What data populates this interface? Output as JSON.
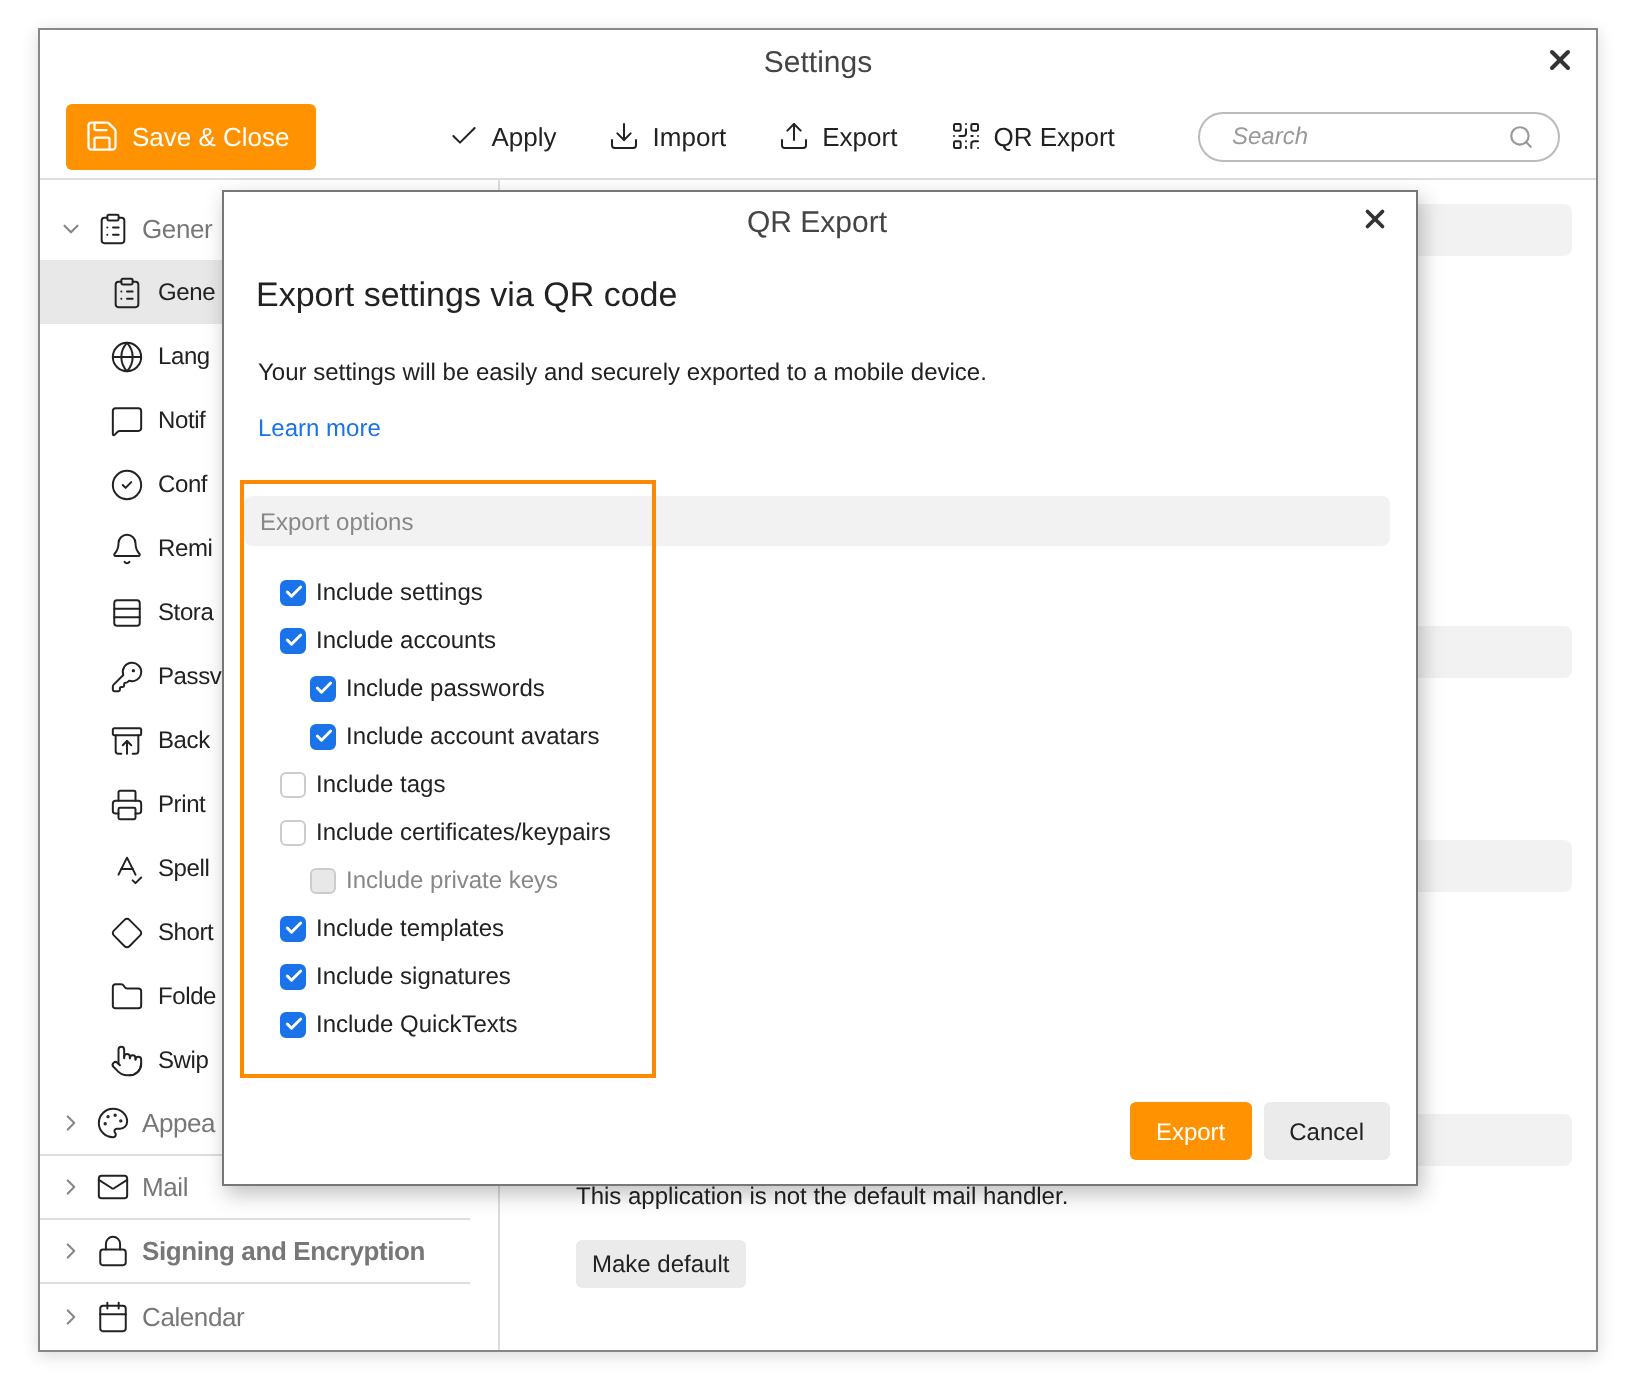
{
  "window": {
    "title": "Settings"
  },
  "toolbar": {
    "primary": "Save & Close",
    "actions": [
      "Apply",
      "Import",
      "Export",
      "QR Export"
    ],
    "search": {
      "placeholder": "Search"
    }
  },
  "sidebar": {
    "groups": [
      {
        "label": "Gener",
        "expanded": true,
        "children": [
          {
            "label": "Gene",
            "selected": true
          },
          {
            "label": "Lang",
            "selected": false
          },
          {
            "label": "Notif",
            "selected": false
          },
          {
            "label": "Conf",
            "selected": false
          },
          {
            "label": "Remi",
            "selected": false
          },
          {
            "label": "Stora",
            "selected": false
          },
          {
            "label": "Passv",
            "selected": false
          },
          {
            "label": "Back",
            "selected": false
          },
          {
            "label": "Print",
            "selected": false
          },
          {
            "label": "Spell",
            "selected": false
          },
          {
            "label": "Short",
            "selected": false
          },
          {
            "label": "Folde",
            "selected": false
          },
          {
            "label": "Swip",
            "selected": false
          }
        ]
      },
      {
        "label": "Appea",
        "expanded": false
      },
      {
        "label": "Mail",
        "expanded": false
      },
      {
        "label": "Signing and Encryption",
        "expanded": false
      },
      {
        "label": "Calendar",
        "expanded": false
      }
    ]
  },
  "content": {
    "notice": "This application is not the default mail handler.",
    "button": "Make default"
  },
  "dialog": {
    "title": "QR Export",
    "heading": "Export settings via QR code",
    "description": "Your settings will be easily and securely exported to a mobile device.",
    "link": "Learn more",
    "options": {
      "title": "Export options",
      "highlighted": true,
      "items": [
        {
          "label": "Include settings",
          "checked": true,
          "disabled": false
        },
        {
          "label": "Include accounts",
          "checked": true,
          "disabled": false,
          "children": [
            {
              "label": "Include passwords",
              "checked": true,
              "disabled": false
            },
            {
              "label": "Include account avatars",
              "checked": true,
              "disabled": false
            }
          ]
        },
        {
          "label": "Include tags",
          "checked": false,
          "disabled": false
        },
        {
          "label": "Include certificates/keypairs",
          "checked": false,
          "disabled": false,
          "children": [
            {
              "label": "Include private keys",
              "checked": false,
              "disabled": true
            }
          ]
        },
        {
          "label": "Include templates",
          "checked": true,
          "disabled": false
        },
        {
          "label": "Include signatures",
          "checked": true,
          "disabled": false
        },
        {
          "label": "Include QuickTexts",
          "checked": true,
          "disabled": false
        }
      ]
    },
    "buttons": [
      {
        "label": "Export",
        "kind": "primary"
      },
      {
        "label": "Cancel",
        "kind": "secondary"
      }
    ]
  }
}
